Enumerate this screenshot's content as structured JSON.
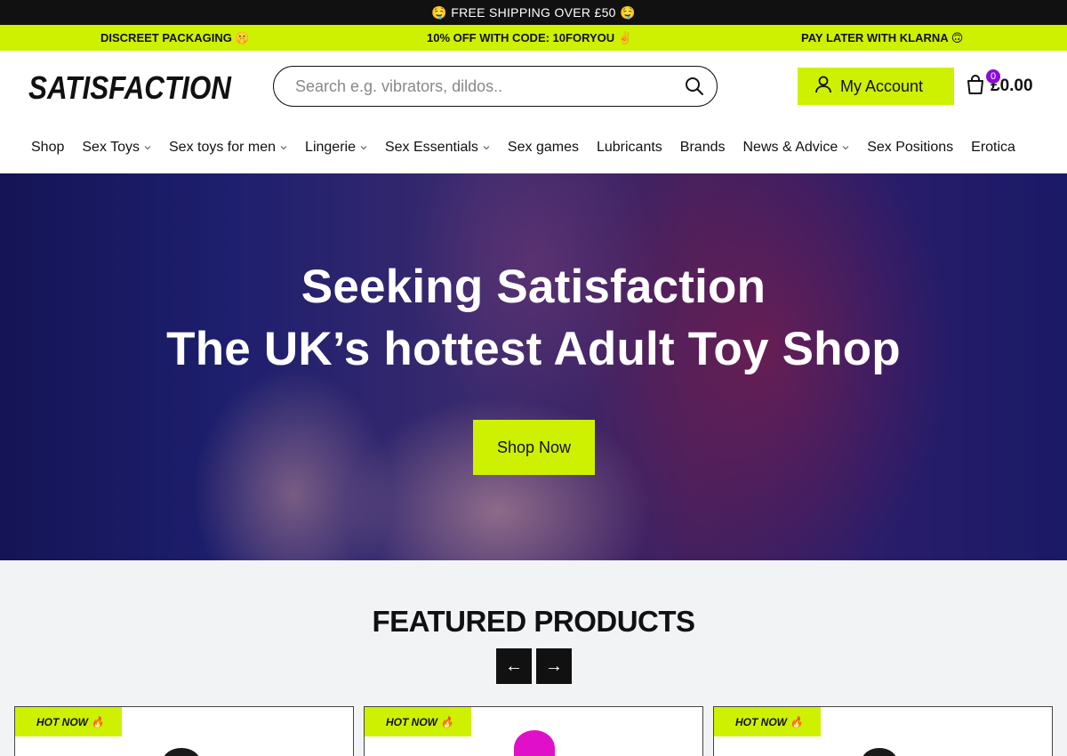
{
  "topbar": {
    "text": "🤤 FREE SHIPPING OVER £50 🤤"
  },
  "promo": [
    {
      "text": "DISCREET PACKAGING 🤫"
    },
    {
      "text": "10% OFF WITH CODE: 10FORYOU ✌️"
    },
    {
      "text": "PAY LATER WITH KLARNA 🙃"
    }
  ],
  "header": {
    "logo_text": "SATISFACTION",
    "search_placeholder": "Search e.g. vibrators, dildos..",
    "account_label": "My Account",
    "cart_count": "0",
    "cart_total": "£0.00"
  },
  "nav": [
    {
      "label": "Shop"
    },
    {
      "label": "Sex Toys"
    },
    {
      "label": "Sex toys for men"
    },
    {
      "label": "Lingerie"
    },
    {
      "label": "Sex Essentials"
    },
    {
      "label": "Sex games"
    },
    {
      "label": "Lubricants"
    },
    {
      "label": "Brands"
    },
    {
      "label": "News & Advice"
    },
    {
      "label": "Sex Positions"
    },
    {
      "label": "Erotica"
    }
  ],
  "hero": {
    "line1": "Seeking Satisfaction",
    "line2": "The UK’s hottest Adult Toy Shop",
    "button": "Shop Now"
  },
  "featured": {
    "title": "FEATURED PRODUCTS",
    "prev_arrow": "←",
    "next_arrow": "→",
    "cards": [
      {
        "badge": "HOT NOW 🔥",
        "color": "#1a1a1a"
      },
      {
        "badge": "HOT NOW 🔥",
        "color": "#e010c8"
      },
      {
        "badge": "HOT NOW 🔥",
        "color": "#1a1a1a"
      }
    ]
  },
  "colors": {
    "accent": "#cef102",
    "dark": "#111111",
    "cart_badge": "#8c0bd8"
  }
}
